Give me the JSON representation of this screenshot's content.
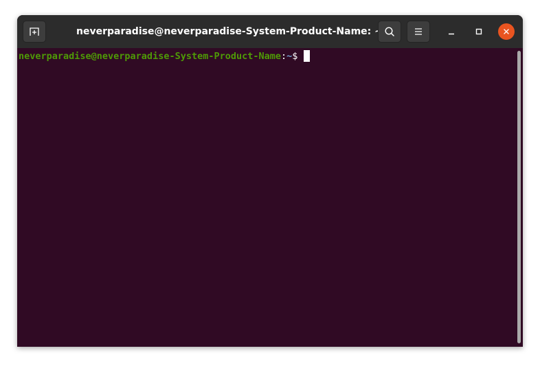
{
  "window": {
    "title": "neverparadise@neverparadise-System-Product-Name: ~"
  },
  "header": {
    "new_tab_icon": "new-tab-icon",
    "search_icon": "search-icon",
    "menu_icon": "hamburger-menu-icon",
    "minimize_icon": "minimize-icon",
    "maximize_icon": "maximize-icon",
    "close_icon": "close-icon"
  },
  "terminal": {
    "user_host": "neverparadise@neverparadise-System-Product-Name",
    "colon": ":",
    "path": "~",
    "prompt_symbol": "$"
  },
  "colors": {
    "terminal_bg": "#300a24",
    "titlebar_bg": "#2c2c2c",
    "user_host": "#4e9a06",
    "path": "#729fcf",
    "close_button": "#e95420"
  }
}
